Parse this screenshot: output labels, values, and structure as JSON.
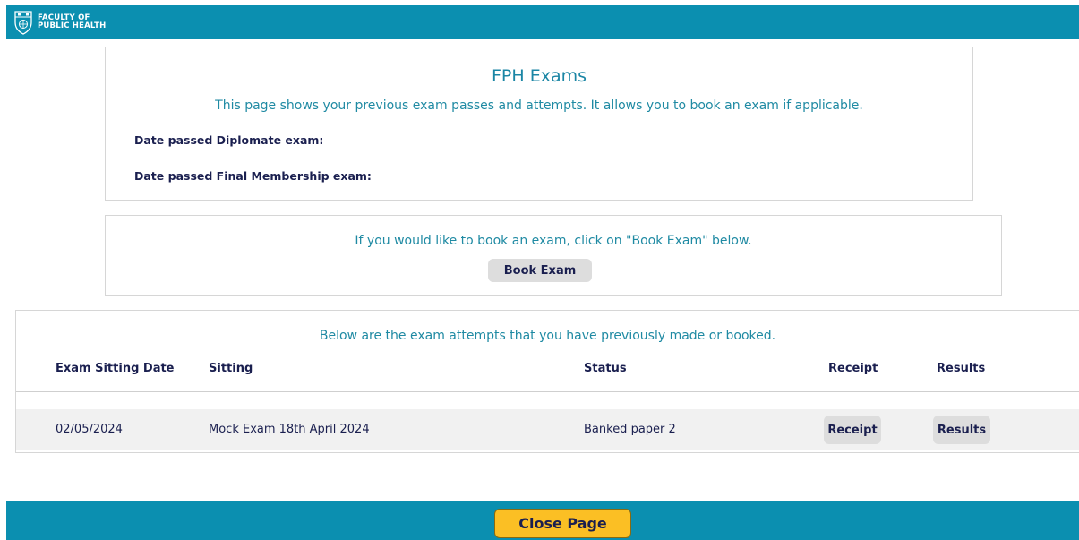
{
  "header": {
    "logo_text": "FACULTY OF\nPUBLIC HEALTH",
    "brand_color": "#0b8fb0",
    "logo_icon": "shield-crest-icon"
  },
  "intro": {
    "title": "FPH Exams",
    "description": "This page shows your previous exam passes and attempts. It allows you to book an exam if applicable.",
    "diplomate_label": "Date passed Diplomate exam:",
    "final_membership_label": "Date passed Final Membership exam:"
  },
  "booking": {
    "instruction": "If you would like to book an exam, click on \"Book Exam\" below.",
    "button_label": "Book Exam"
  },
  "attempts": {
    "intro": "Below are the exam attempts that you have previously made or booked.",
    "columns": [
      "Exam Sitting Date",
      "Sitting",
      "Status",
      "Receipt",
      "Results"
    ],
    "rows": [
      {
        "date": "02/05/2024",
        "sitting": "Mock Exam 18th April 2024",
        "status": "Banked paper 2",
        "receipt_label": "Receipt",
        "results_label": "Results"
      }
    ]
  },
  "footer": {
    "close_label": "Close Page",
    "close_color": "#fbbf24"
  }
}
